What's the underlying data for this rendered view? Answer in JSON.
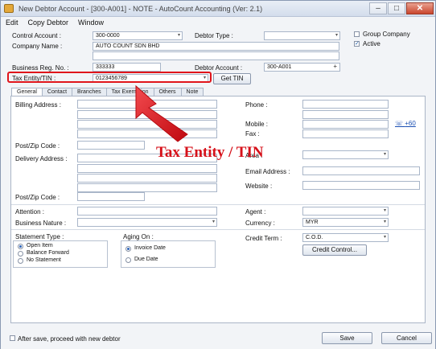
{
  "window": {
    "title": "New Debtor Account - [300-A001] - NOTE - AutoCount Accounting (Ver: 2.1)"
  },
  "menu": [
    "Edit",
    "Copy Debtor",
    "Window"
  ],
  "header": {
    "control_account_label": "Control Account :",
    "control_account_value": "300-0000",
    "debtor_type_label": "Debtor Type :",
    "debtor_type_value": "",
    "group_company_label": "Group Company",
    "group_company_checked": false,
    "active_label": "Active",
    "active_checked": true,
    "company_name_label": "Company Name :",
    "company_name_value": "AUTO COUNT SDN BHD",
    "company_name_2": "",
    "reg_no_label": "Business Reg. No. :",
    "reg_no_value": "333333",
    "debtor_account_label": "Debtor Account :",
    "debtor_account_value": "300-A001",
    "tin_label": "Tax Entity/TIN :",
    "tin_value": "0123456789",
    "get_tin_label": "Get TIN"
  },
  "tabs": [
    "General",
    "Contact",
    "Branches",
    "Tax Exemption",
    "Others",
    "Note"
  ],
  "active_tab": "General",
  "general": {
    "billing_address_label": "Billing Address :",
    "post_zip_label": "Post/Zip Code :",
    "delivery_address_label": "Delivery Address :",
    "post_zip_label_2": "Post/Zip Code :",
    "phone_label": "Phone :",
    "mobile_label": "Mobile :",
    "fax_label": "Fax :",
    "area_label": "Area :",
    "email_label": "Email  Address :",
    "website_label": "Website :",
    "link_label": "+60",
    "attention_label": "Attention :",
    "business_nature_label": "Business Nature :",
    "agent_label": "Agent :",
    "currency_label": "Currency :",
    "currency_value": "MYR",
    "statement_type_label": "Statement Type :",
    "statement_options": [
      "Open Item",
      "Balance Forward",
      "No Statement"
    ],
    "statement_selected": "Open Item",
    "aging_on_label": "Aging On :",
    "aging_options": [
      "Invoice Date",
      "Due Date"
    ],
    "aging_selected": "Invoice Date",
    "credit_term_label": "Credit Term :",
    "credit_term_value": "C.O.D.",
    "credit_control_label": "Credit Control..."
  },
  "annotation": {
    "text": "Tax Entity /  TIN",
    "color": "#d6111a"
  },
  "footer": {
    "after_save_label": "After save, proceed with new debtor",
    "after_save_checked": false,
    "save_label": "Save",
    "cancel_label": "Cancel"
  }
}
